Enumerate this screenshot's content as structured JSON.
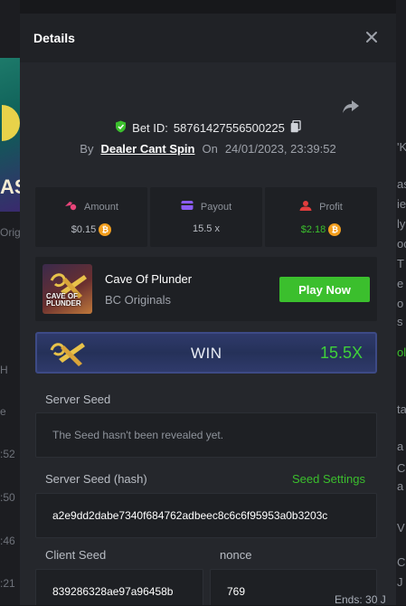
{
  "background": {
    "left_thumb_text": "AS",
    "left_side_texts": [
      "Origi",
      "H",
      "e",
      ":52",
      ":50",
      ":46",
      ":21"
    ],
    "right_side_texts": [
      "'K",
      "as",
      "ie",
      "ly",
      "oc",
      "T",
      "e",
      "o",
      "s",
      "oli",
      "a",
      "ta",
      "a",
      "C",
      "V",
      "C",
      "J"
    ],
    "bottom_right_text": "Ends: 30 J"
  },
  "modal": {
    "title": "Details",
    "close_icon": "close-icon",
    "share_icon": "share-icon"
  },
  "bet": {
    "shield_icon": "shield-check-icon",
    "id_label": "Bet ID:",
    "id_value": "58761427556500225",
    "copy_icon": "copy-icon",
    "by_label": "By",
    "user": "Dealer Cant Spin",
    "on_label": "On",
    "datetime": "24/01/2023, 23:39:52"
  },
  "stats": {
    "amount": {
      "label": "Amount",
      "value": "$0.15",
      "icon": "money-icon",
      "icon_color": "#e8457a"
    },
    "payout": {
      "label": "Payout",
      "value": "15.5 x",
      "icon": "wallet-icon",
      "icon_color": "#8b5cf6"
    },
    "profit": {
      "label": "Profit",
      "value": "$2.18",
      "icon": "profit-icon",
      "icon_color": "#e23d3d"
    }
  },
  "game": {
    "thumb_text": "CAVE OF PLUNDER",
    "name": "Cave Of Plunder",
    "provider": "BC Originals",
    "play_label": "Play Now"
  },
  "result": {
    "label": "WIN",
    "multiplier": "15.5X"
  },
  "fairness": {
    "server_seed_label": "Server Seed",
    "server_seed_value": "The Seed hasn't been revealed yet.",
    "server_seed_hash_label": "Server Seed (hash)",
    "seed_settings_label": "Seed Settings",
    "server_seed_hash_value": "a2e9dd2dabe7340f684762adbeec8c6c6f95953a0b3203c",
    "client_seed_label": "Client Seed",
    "client_seed_value": "839286328ae97a96458b",
    "nonce_label": "nonce",
    "nonce_value": "769"
  },
  "colors": {
    "accent_green": "#3bbf2d",
    "coin": "#f29e1e",
    "modal_bg": "#25272c"
  }
}
